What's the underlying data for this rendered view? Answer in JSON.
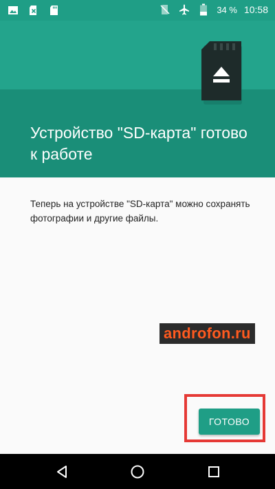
{
  "status_bar": {
    "battery_percent": "34 %",
    "time": "10:58",
    "icons_left": [
      "image-icon",
      "sd-card-error-icon",
      "sd-card-icon"
    ],
    "icons_right": [
      "no-sim-icon",
      "airplane-mode-icon",
      "battery-icon"
    ]
  },
  "hero": {
    "title": "Устройство \"SD-карта\" готово к работе",
    "illustration": "sd-card-eject-icon"
  },
  "body": {
    "text": "Теперь на устройстве \"SD-карта\" можно сохранять фотографии и другие файлы."
  },
  "watermark": {
    "text": "androfon.ru"
  },
  "actions": {
    "done_label": "ГОТОВО"
  },
  "nav_bar": {
    "buttons": [
      "back-icon",
      "home-icon",
      "recents-icon"
    ]
  },
  "colors": {
    "accent": "#1f9e86",
    "hero": "#23a48c",
    "hero_band": "#1a8e78",
    "highlight": "#e53935",
    "watermark_text": "#ff5a1f"
  }
}
